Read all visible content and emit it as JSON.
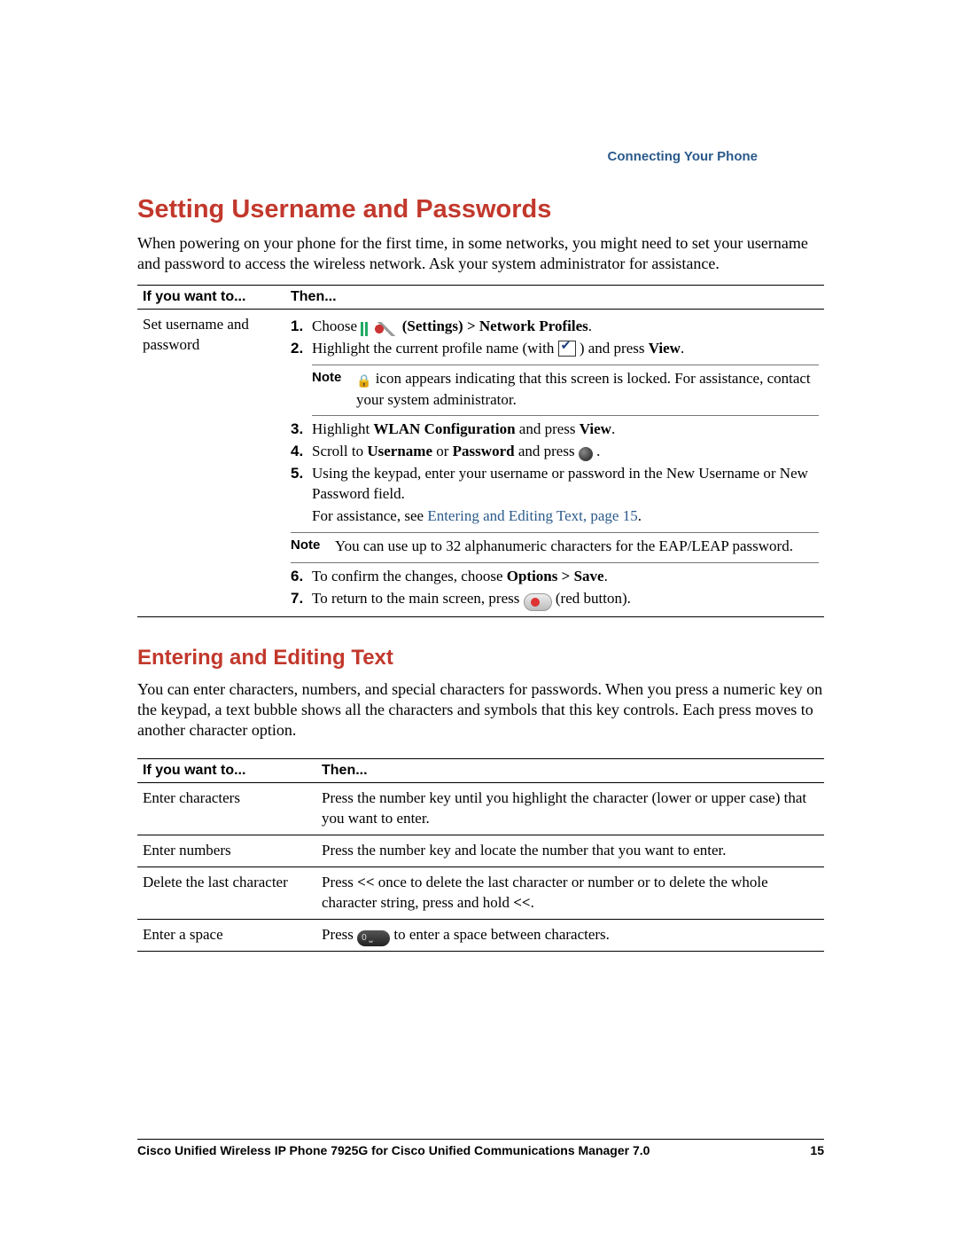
{
  "header": {
    "section": "Connecting Your Phone"
  },
  "h1": "Setting Username and Passwords",
  "intro1": "When powering on your phone for the first time, in some networks, you might need to set your username and password to access the wireless network. Ask your system administrator for assistance.",
  "table1": {
    "col1": "If you want to...",
    "col2": "Then...",
    "row1_label": "Set username and password",
    "steps": {
      "s1_pre": "Choose ",
      "s1_settings": " (Settings) > Network Profiles",
      "s2_pre": "Highlight the current profile name (with ",
      "s2_post": ") and press ",
      "s2_view": "View",
      "note1_a": " icon appears indicating that this screen is locked. For assistance, contact your system administrator.",
      "s3_a": "Highlight ",
      "s3_b": "WLAN Configuration",
      "s3_c": " and press ",
      "s3_d": "View",
      "s4_a": "Scroll to ",
      "s4_b": "Username",
      "s4_c": " or ",
      "s4_d": "Password",
      "s4_e": " and press ",
      "s5": "Using the keypad, enter your username or password in the New Username or New Password field.",
      "assist_a": "For assistance, see ",
      "assist_link": "Entering and Editing Text, page 15",
      "note2": "You can use up to 32 alphanumeric characters for the EAP/LEAP password.",
      "s6_a": "To confirm the changes, choose ",
      "s6_b": "Options > Save",
      "s7_a": "To return to the main screen, press ",
      "s7_b": " (red button)."
    },
    "note_label": "Note"
  },
  "h2": "Entering and Editing Text",
  "intro2": "You can enter characters, numbers, and special characters for passwords. When you press a numeric key on the keypad, a text bubble shows all the characters and symbols that this key controls. Each press moves to another character option.",
  "table2": {
    "col1": "If you want to...",
    "col2": "Then...",
    "rows": [
      {
        "l": "Enter characters",
        "r": "Press the number key until you highlight the character (lower or upper case) that you want to enter."
      },
      {
        "l": "Enter numbers",
        "r": "Press the number key and locate the number that you want to enter."
      },
      {
        "l": "Delete the last character",
        "r_a": "Press ",
        "r_b": "<<",
        "r_c": " once to delete the last character or number or to delete the whole character string, press and hold ",
        "r_d": "<<",
        "r_e": "."
      },
      {
        "l": "Enter a space",
        "r_a": "Press ",
        "r_b": " to enter a space between characters."
      }
    ]
  },
  "footer": {
    "doc": "Cisco Unified Wireless IP Phone 7925G for Cisco Unified Communications Manager 7.0",
    "page": "15"
  },
  "period": "."
}
